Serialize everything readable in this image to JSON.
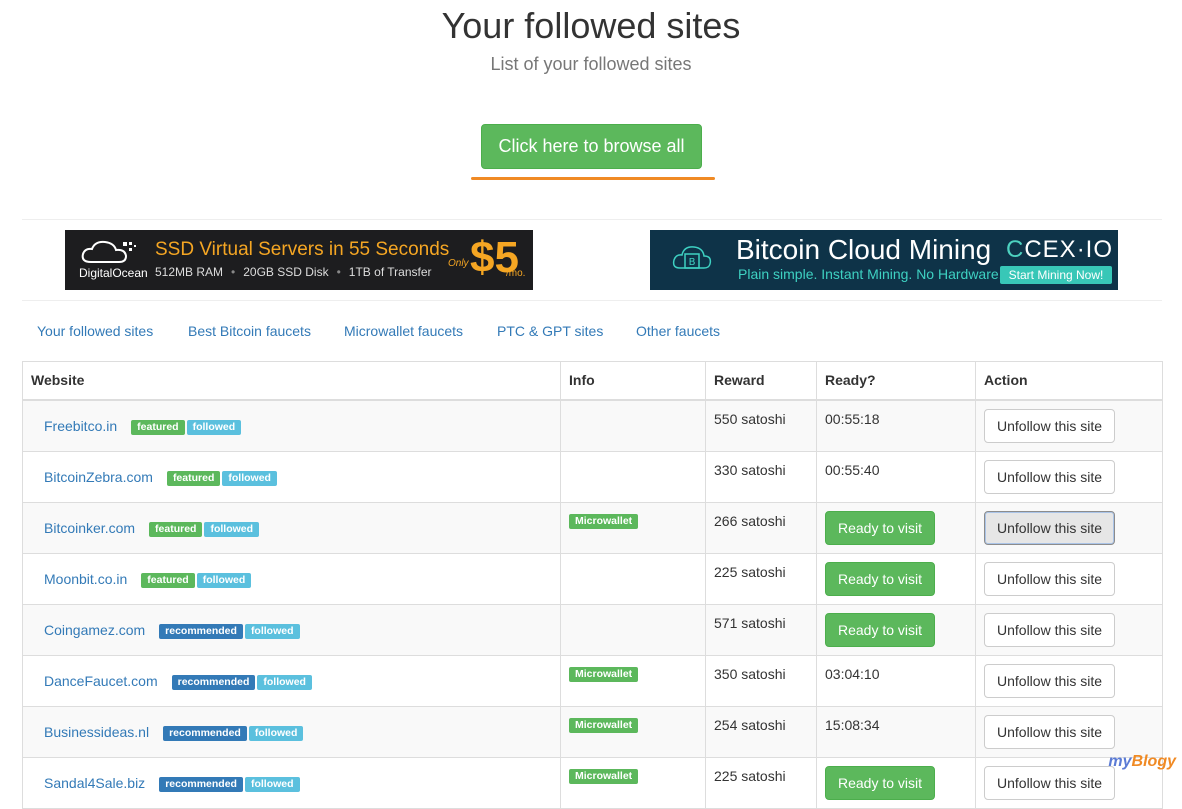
{
  "header": {
    "title": "Your followed sites",
    "subtitle": "List of your followed sites",
    "browse_label": "Click here to browse all"
  },
  "ads": {
    "digitalocean": {
      "brand": "DigitalOcean",
      "headline": "SSD Virtual Servers in 55 Seconds",
      "spec1": "512MB RAM",
      "spec2": "20GB SSD Disk",
      "spec3": "1TB of Transfer",
      "only": "Only",
      "price": "$5",
      "per": "/mo."
    },
    "cex": {
      "headline": "Bitcoin Cloud Mining",
      "logo_mark": "C",
      "logo_text": "CEX·IO",
      "tagline": "Plain simple. Instant Mining. No Hardware.",
      "cta": "Start Mining Now!"
    }
  },
  "tabs": [
    {
      "label": "Your followed sites"
    },
    {
      "label": "Best Bitcoin faucets"
    },
    {
      "label": "Microwallet faucets"
    },
    {
      "label": "PTC & GPT sites"
    },
    {
      "label": "Other faucets"
    }
  ],
  "table": {
    "headers": {
      "website": "Website",
      "info": "Info",
      "reward": "Reward",
      "ready": "Ready?",
      "action": "Action"
    },
    "rows": [
      {
        "site": "Freebitco.in",
        "tag": "featured",
        "followed": "followed",
        "info": "",
        "reward": "550 satoshi",
        "ready": "00:55:18",
        "ready_button": false,
        "action": "Unfollow this site"
      },
      {
        "site": "BitcoinZebra.com",
        "tag": "featured",
        "followed": "followed",
        "info": "",
        "reward": "330 satoshi",
        "ready": "00:55:40",
        "ready_button": false,
        "action": "Unfollow this site"
      },
      {
        "site": "Bitcoinker.com",
        "tag": "featured",
        "followed": "followed",
        "info": "Microwallet",
        "reward": "266 satoshi",
        "ready": "Ready to visit",
        "ready_button": true,
        "action": "Unfollow this site"
      },
      {
        "site": "Moonbit.co.in",
        "tag": "featured",
        "followed": "followed",
        "info": "",
        "reward": "225 satoshi",
        "ready": "Ready to visit",
        "ready_button": true,
        "action": "Unfollow this site"
      },
      {
        "site": "Coingamez.com",
        "tag": "recommended",
        "followed": "followed",
        "info": "",
        "reward": "571 satoshi",
        "ready": "Ready to visit",
        "ready_button": true,
        "action": "Unfollow this site"
      },
      {
        "site": "DanceFaucet.com",
        "tag": "recommended",
        "followed": "followed",
        "info": "Microwallet",
        "reward": "350 satoshi",
        "ready": "03:04:10",
        "ready_button": false,
        "action": "Unfollow this site"
      },
      {
        "site": "Businessideas.nl",
        "tag": "recommended",
        "followed": "followed",
        "info": "Microwallet",
        "reward": "254 satoshi",
        "ready": "15:08:34",
        "ready_button": false,
        "action": "Unfollow this site"
      },
      {
        "site": "Sandal4Sale.biz",
        "tag": "recommended",
        "followed": "followed",
        "info": "Microwallet",
        "reward": "225 satoshi",
        "ready": "Ready to visit",
        "ready_button": true,
        "action": "Unfollow this site"
      }
    ]
  },
  "watermark": {
    "pre": "my",
    "post": "Blogy"
  },
  "colors": {
    "green": "#5cb85c",
    "blue": "#337ab7",
    "info": "#5bc0de",
    "accent": "#f08a24"
  }
}
